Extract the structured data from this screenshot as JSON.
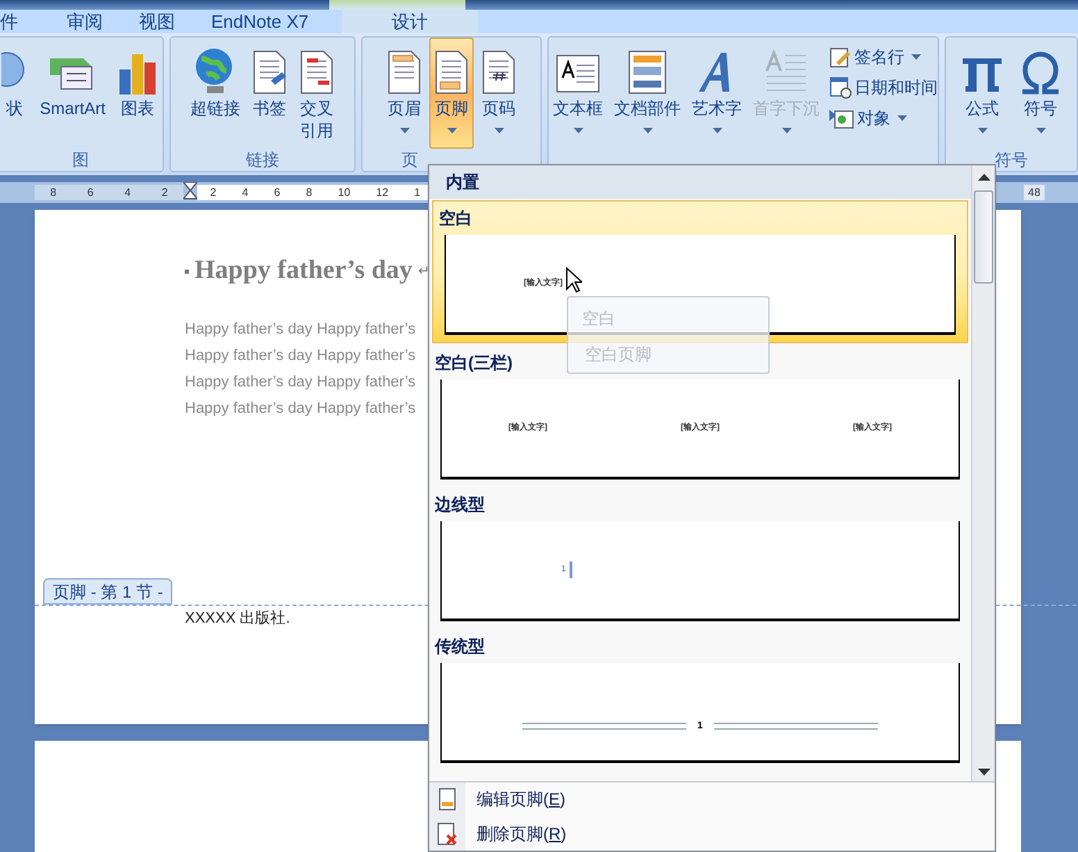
{
  "tabs": [
    {
      "label": "件",
      "contextual": false
    },
    {
      "label": "审阅",
      "contextual": false
    },
    {
      "label": "视图",
      "contextual": false
    },
    {
      "label": "EndNote X7",
      "contextual": false
    },
    {
      "label": "设计",
      "contextual": true
    }
  ],
  "ribbon": {
    "groups": [
      {
        "label": "图",
        "buttons": [
          {
            "label": "状",
            "kind": "shapes",
            "dropdown": false,
            "selected": false,
            "disabled": false
          },
          {
            "label": "SmartArt",
            "kind": "smartart",
            "dropdown": false,
            "selected": false,
            "disabled": false
          },
          {
            "label": "图表",
            "kind": "chart",
            "dropdown": false,
            "selected": false,
            "disabled": false
          }
        ]
      },
      {
        "label": "链接",
        "buttons": [
          {
            "label": "超链接",
            "kind": "globe",
            "dropdown": false,
            "selected": false,
            "disabled": false
          },
          {
            "label": "书签",
            "kind": "bookmark",
            "dropdown": false,
            "selected": false,
            "disabled": false
          },
          {
            "label": "交叉引用",
            "kind": "crossref",
            "dropdown": false,
            "selected": false,
            "disabled": false
          }
        ]
      },
      {
        "label": "页",
        "buttons": [
          {
            "label": "页眉",
            "kind": "header",
            "dropdown": true,
            "selected": false,
            "disabled": false
          },
          {
            "label": "页脚",
            "kind": "footer",
            "dropdown": true,
            "selected": true,
            "disabled": false
          },
          {
            "label": "页码",
            "kind": "pagenum",
            "dropdown": true,
            "selected": false,
            "disabled": false
          }
        ]
      },
      {
        "buttons": [
          {
            "label": "文本框",
            "kind": "textbox",
            "dropdown": true,
            "selected": false,
            "disabled": false
          },
          {
            "label": "文档部件",
            "kind": "parts",
            "dropdown": true,
            "selected": false,
            "disabled": false
          },
          {
            "label": "艺术字",
            "kind": "wordart",
            "dropdown": true,
            "selected": false,
            "disabled": false
          },
          {
            "label": "首字下沉",
            "kind": "dropcap",
            "dropdown": true,
            "selected": false,
            "disabled": true
          }
        ],
        "small_buttons": [
          {
            "label": "签名行",
            "kind": "signature",
            "dropdown": true
          },
          {
            "label": "日期和时间",
            "kind": "calendar",
            "dropdown": false
          },
          {
            "label": "对象",
            "kind": "object",
            "dropdown": true
          }
        ]
      },
      {
        "label": "符号",
        "buttons": [
          {
            "label": "公式",
            "kind": "pi",
            "dropdown": true,
            "selected": false,
            "disabled": false
          },
          {
            "label": "符号",
            "kind": "omega",
            "dropdown": true,
            "selected": false,
            "disabled": false
          }
        ]
      }
    ]
  },
  "ruler": {
    "left_ticks": [
      "8",
      "6",
      "4",
      "2"
    ],
    "right_ticks": [
      "2",
      "4",
      "6",
      "8",
      "10",
      "12",
      "1"
    ],
    "end_tick": "48"
  },
  "document": {
    "title": "Happy father’s day",
    "title_mark": "↵",
    "body": [
      "Happy father’s day Happy father’s",
      "Happy father’s day Happy father’s",
      "Happy father’s day Happy father’s",
      "Happy father’s day Happy father’s"
    ],
    "footer_tab": "页脚 - 第 1 节 -",
    "footer_text": "XXXXX 出版社."
  },
  "gallery": {
    "section": "内置",
    "items": [
      {
        "label": "空白",
        "kind": "blank",
        "selected": true,
        "texts": [
          "[输入文字]"
        ]
      },
      {
        "label": "空白(三栏)",
        "kind": "three",
        "selected": false,
        "texts": [
          "[输入文字]",
          "[输入文字]",
          "[输入文字]"
        ]
      },
      {
        "label": "边线型",
        "kind": "sideline",
        "selected": false,
        "texts": [
          "1"
        ]
      },
      {
        "label": "传统型",
        "kind": "traditional",
        "selected": false,
        "texts": [
          "1"
        ]
      }
    ],
    "tooltip": {
      "title": "空白",
      "description": "空白页脚"
    },
    "menu": [
      {
        "before": "编辑页脚(",
        "key": "E",
        "after": ")",
        "kind": "edit"
      },
      {
        "before": "删除页脚(",
        "key": "R",
        "after": ")",
        "kind": "delete"
      }
    ]
  }
}
